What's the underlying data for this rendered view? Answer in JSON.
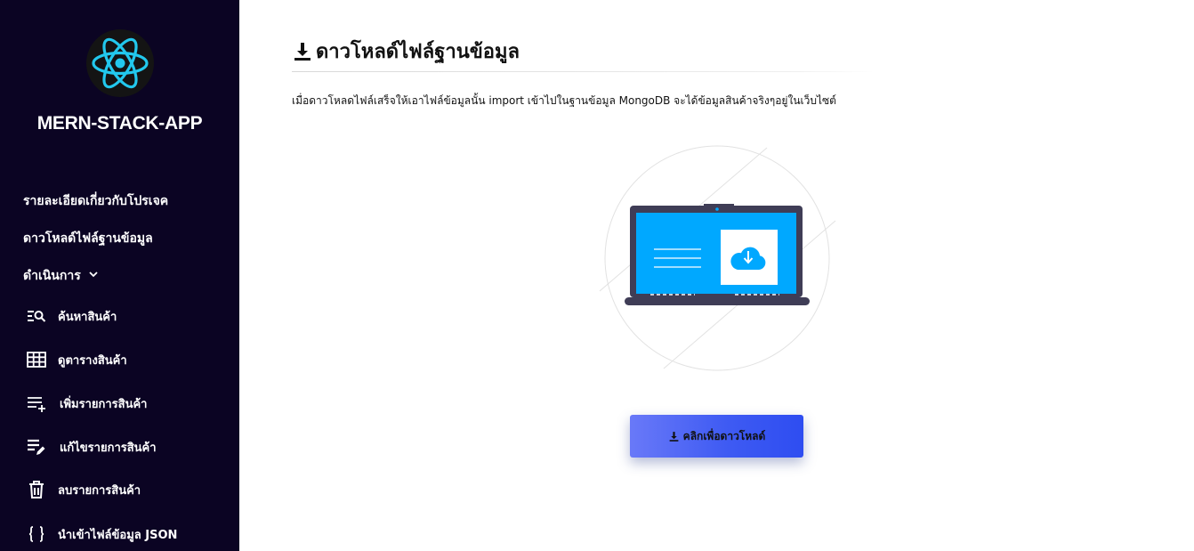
{
  "sidebar": {
    "app_title": "MERN-STACK-APP",
    "logo_icon": "react-atom-icon",
    "nav": {
      "about": "รายละเอียดเกี่ยวกับโปรเจค",
      "download": "ดาวโหลด์ไฟล์ฐานข้อมูล",
      "operations": "ดำเนินการ"
    },
    "submenu": [
      {
        "label": "ค้นหาสินค้า",
        "icon": "search-list-icon"
      },
      {
        "label": "ดูตารางสินค้า",
        "icon": "table-icon"
      },
      {
        "label": "เพิ่มรายการสินค้า",
        "icon": "playlist-add-icon"
      },
      {
        "label": "แก้ไขรายการสินค้า",
        "icon": "playlist-edit-icon"
      },
      {
        "label": "ลบรายการสินค้า",
        "icon": "trash-icon"
      },
      {
        "label": "นำเข้าไฟล์ข้อมูล JSON",
        "icon": "braces-icon"
      }
    ]
  },
  "main": {
    "title": "ดาวโหลด์ไฟล์ฐานข้อมูล",
    "description": "เมื่อดาวโหลดไฟล์เสร็จให้เอาไฟล์ข้อมูลนั้น import เข้าไปในฐานข้อมูล MongoDB จะได้ข้อมูลสินค้าจริงๆอยู่ในเว็บไซต์",
    "download_button": "คลิกเพื่อดาวโหลด์"
  },
  "colors": {
    "sidebar_bg": "#0b0423",
    "accent": "#3f5bf3",
    "screen": "#00a8ff",
    "laptop": "#3f3d56"
  }
}
